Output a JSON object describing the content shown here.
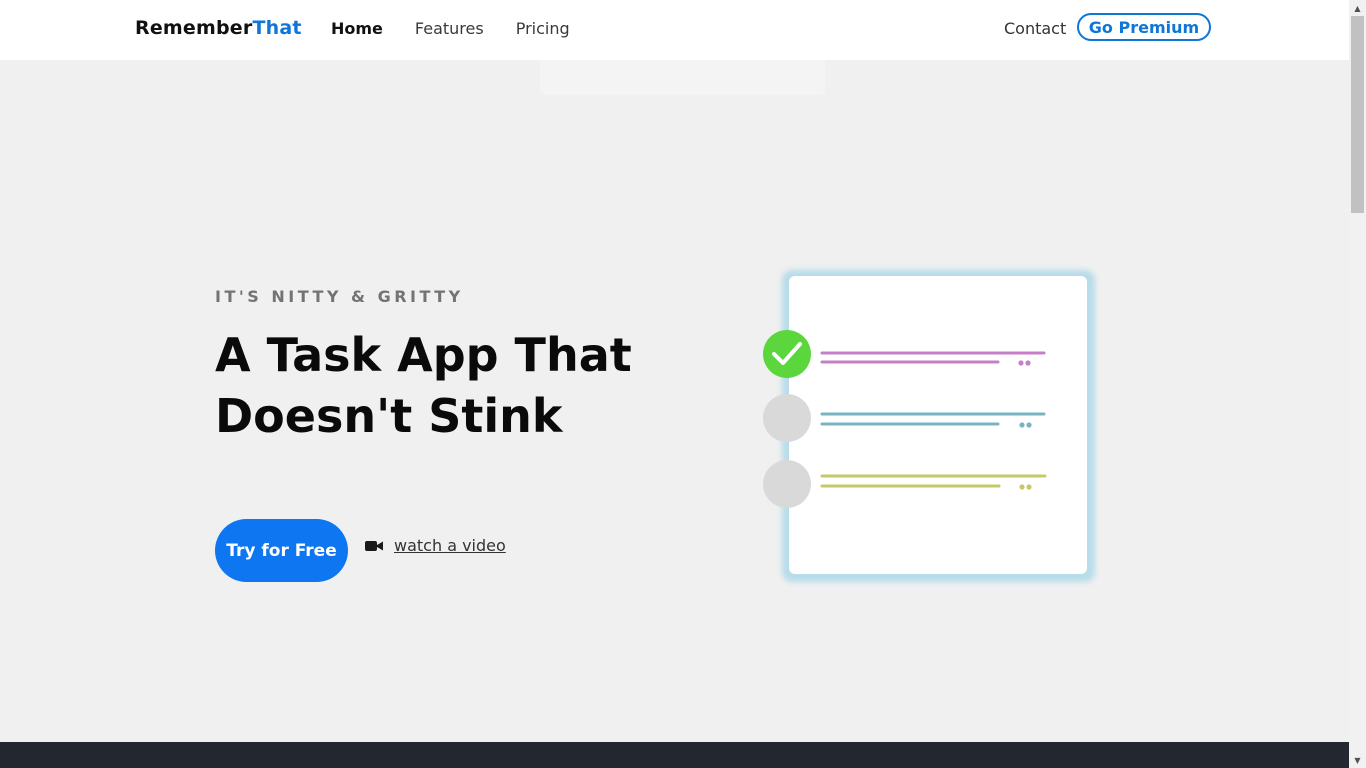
{
  "nav": {
    "brand_part1": "Remember",
    "brand_part2": "That",
    "links": [
      "Home",
      "Features",
      "Pricing"
    ],
    "contact": "Contact",
    "premium": "Go Premium"
  },
  "hero": {
    "eyebrow": "IT'S NITTY & GRITTY",
    "headline_line1": "A Task App That",
    "headline_line2": "Doesn't Stink",
    "cta": "Try for Free",
    "video_link": "watch a video",
    "video_icon": "video-camera-icon"
  },
  "illustration": {
    "tasks": [
      {
        "state": "done",
        "color": "#c47fc7"
      },
      {
        "state": "todo",
        "color": "#7ab3c2"
      },
      {
        "state": "todo",
        "color": "#c6c86a"
      }
    ],
    "check_color": "#5bd63c",
    "card_glow": "#a9d7e8"
  },
  "colors": {
    "brand_accent": "#0d76d9",
    "cta_bg": "#0d76f0",
    "page_bg": "#f0f0f0",
    "footer_bg": "#232830"
  }
}
